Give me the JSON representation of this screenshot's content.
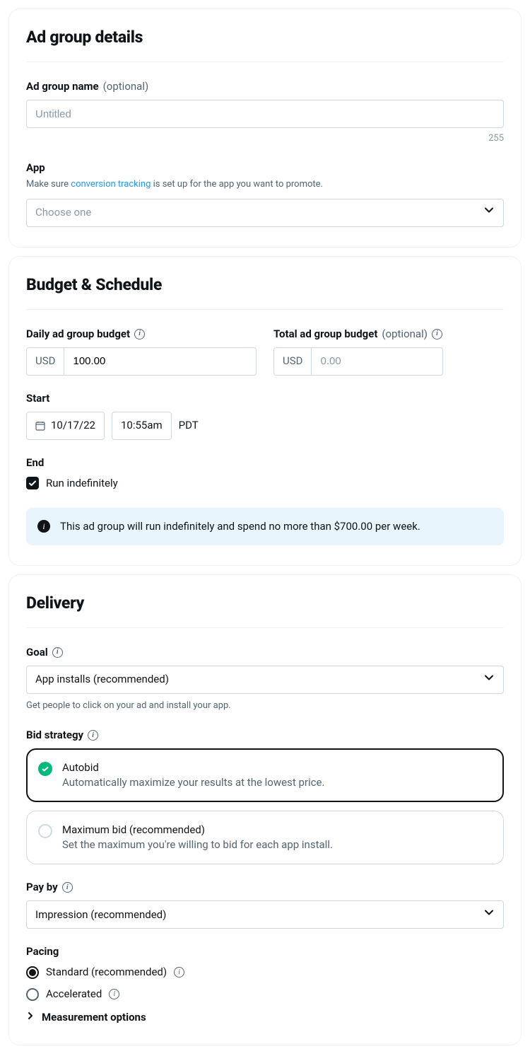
{
  "adGroup": {
    "title": "Ad group details",
    "name": {
      "label": "Ad group name",
      "optional": "(optional)",
      "placeholder": "Untitled",
      "value": "",
      "charCount": "255"
    },
    "app": {
      "label": "App",
      "helperPrefix": "Make sure ",
      "helperLink": "conversion tracking",
      "helperSuffix": " is set up for the app you want to promote.",
      "placeholder": "Choose one"
    }
  },
  "budget": {
    "title": "Budget & Schedule",
    "daily": {
      "label": "Daily ad group budget",
      "currency": "USD",
      "value": "100.00"
    },
    "total": {
      "label": "Total ad group budget",
      "optional": "(optional)",
      "currency": "USD",
      "placeholder": "0.00",
      "value": ""
    },
    "start": {
      "label": "Start",
      "date": "10/17/22",
      "time": "10:55am",
      "tz": "PDT"
    },
    "end": {
      "label": "End",
      "runIndefLabel": "Run indefinitely",
      "checked": true
    },
    "notice": "This ad group will run indefinitely and spend no more than $700.00 per week."
  },
  "delivery": {
    "title": "Delivery",
    "goal": {
      "label": "Goal",
      "value": "App installs (recommended)",
      "desc": "Get people to click on your ad and install your app."
    },
    "bidStrategy": {
      "label": "Bid strategy",
      "options": [
        {
          "title": "Autobid",
          "sub": "Automatically maximize your results at the lowest price.",
          "selected": true
        },
        {
          "title": "Maximum bid (recommended)",
          "sub": "Set the maximum you're willing to bid for each app install.",
          "selected": false
        }
      ]
    },
    "payBy": {
      "label": "Pay by",
      "value": "Impression (recommended)"
    },
    "pacing": {
      "label": "Pacing",
      "options": [
        {
          "label": "Standard (recommended)",
          "selected": true
        },
        {
          "label": "Accelerated",
          "selected": false
        }
      ]
    },
    "measurement": {
      "label": "Measurement options"
    }
  }
}
